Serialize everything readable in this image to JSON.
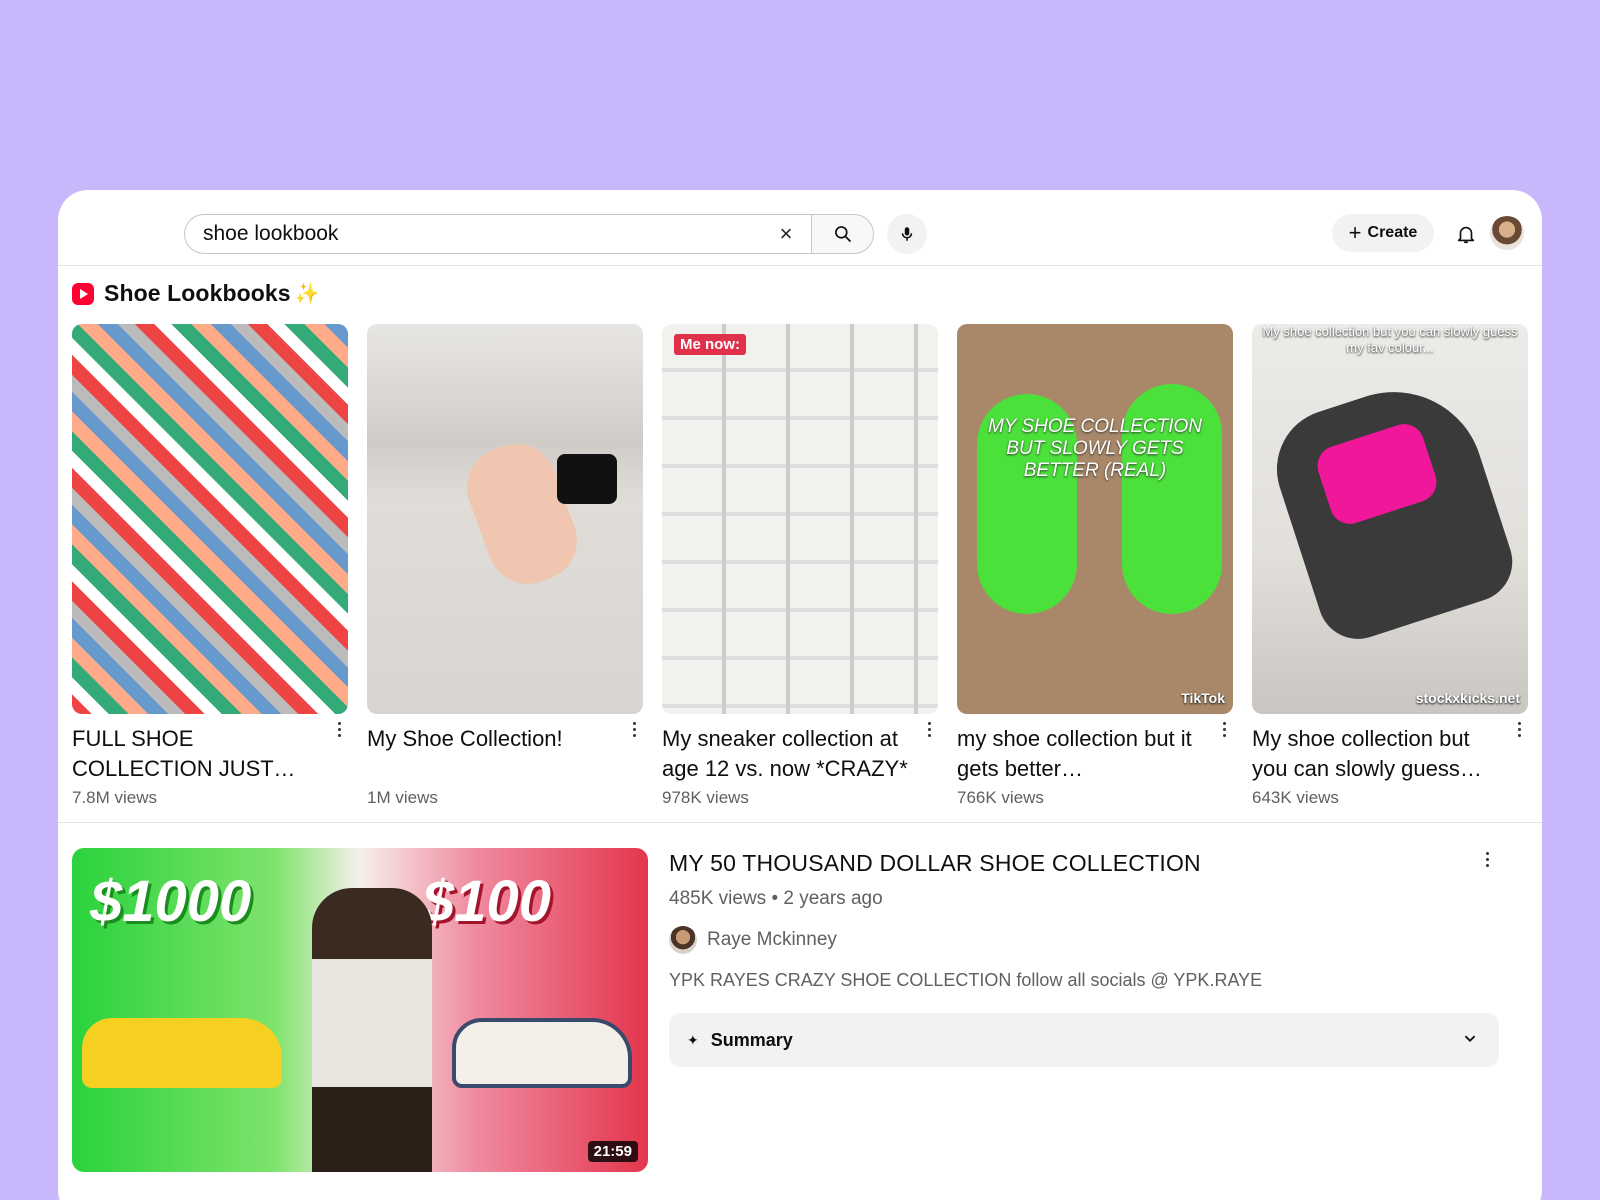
{
  "search": {
    "value": "shoe lookbook",
    "clear_icon": "close-icon",
    "submit_icon": "search-icon",
    "mic_icon": "mic-icon"
  },
  "header": {
    "create_label": "Create",
    "notifications_icon": "bell-icon"
  },
  "shorts_section": {
    "title": "Shoe Lookbooks",
    "items": [
      {
        "title": "FULL SHOE COLLECTION JUST POSTED ON MY…",
        "views": "7.8M views"
      },
      {
        "title": "My Shoe Collection!",
        "views": "1M views"
      },
      {
        "title": "My sneaker collection at age 12 vs. now *CRAZY*",
        "views": "978K views",
        "badge": "Me now:"
      },
      {
        "title": "my shoe collection but it gets better…",
        "views": "766K views",
        "overlay": "MY SHOE COLLECTION BUT SLOWLY GETS BETTER (REAL)",
        "watermark": "TikTok"
      },
      {
        "title": "My shoe collection but you can slowly guess m…",
        "views": "643K views",
        "overlay": "My shoe collection but you can slowly guess my fav colour...",
        "watermark": "stockxkicks.net"
      }
    ]
  },
  "video": {
    "title": "MY 50 THOUSAND DOLLAR SHOE COLLECTION",
    "meta": "485K views • 2 years ago",
    "channel": "Raye Mckinney",
    "description": "YPK RAYES CRAZY SHOE COLLECTION follow all socials @ YPK.RAYE",
    "duration": "21:59",
    "thumb_text_left": "$1000",
    "thumb_text_right": "$100",
    "summary_label": "Summary"
  },
  "colors": {
    "background": "#c8b8fb",
    "brand_red": "#ff0033"
  }
}
